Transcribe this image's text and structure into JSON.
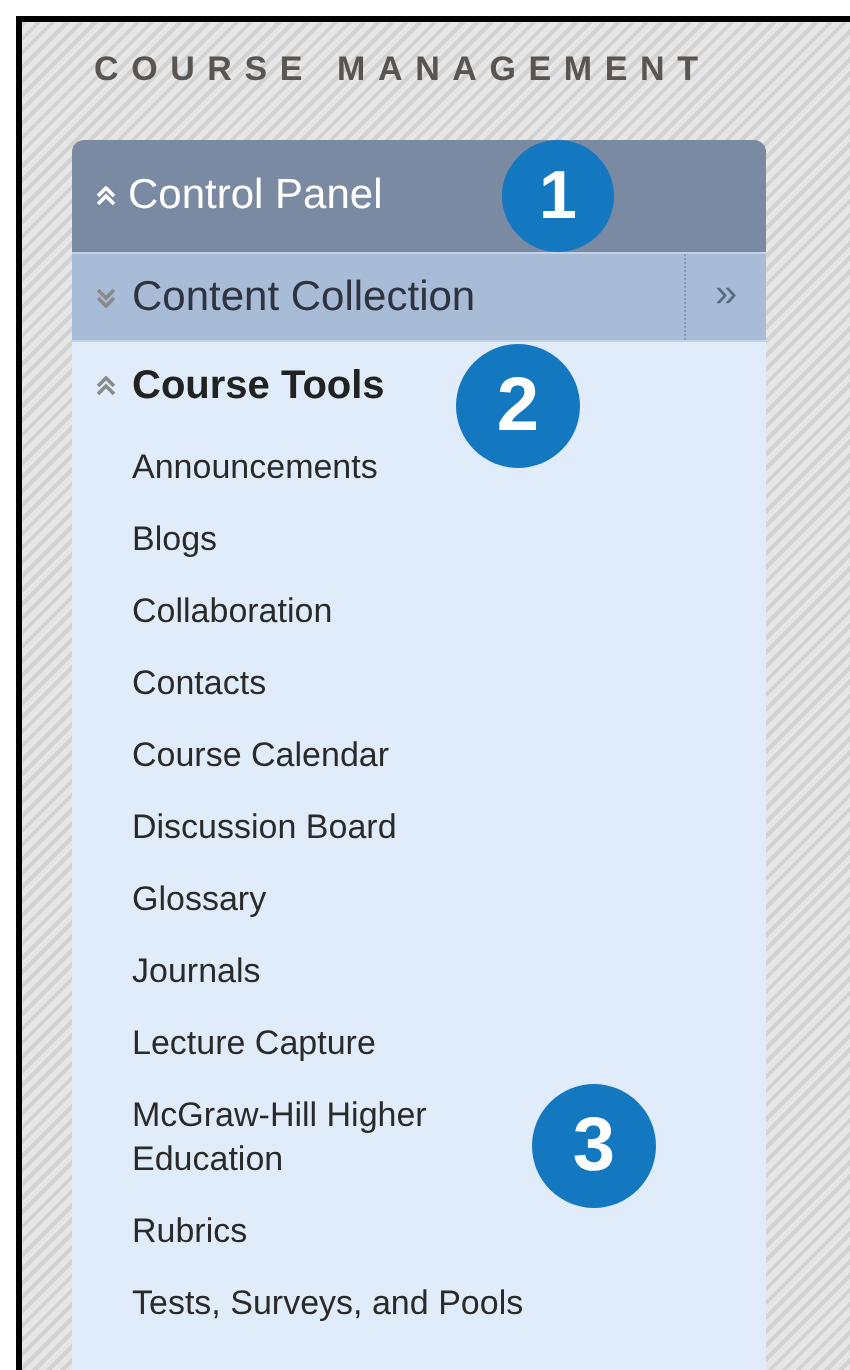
{
  "heading": "COURSE MANAGEMENT",
  "panel": {
    "title": "Control Panel",
    "expanded": true
  },
  "sections": [
    {
      "kind": "link",
      "label": "Content Collection",
      "expanded": false,
      "trailing": "»"
    },
    {
      "kind": "group",
      "label": "Course Tools",
      "expanded": true,
      "items": [
        "Announcements",
        "Blogs",
        "Collaboration",
        "Contacts",
        "Course Calendar",
        "Discussion Board",
        "Glossary",
        "Journals",
        "Lecture Capture",
        "McGraw-Hill Higher Education",
        "Rubrics",
        "Tests, Surveys, and Pools"
      ]
    }
  ],
  "callouts": [
    "1",
    "2",
    "3"
  ]
}
